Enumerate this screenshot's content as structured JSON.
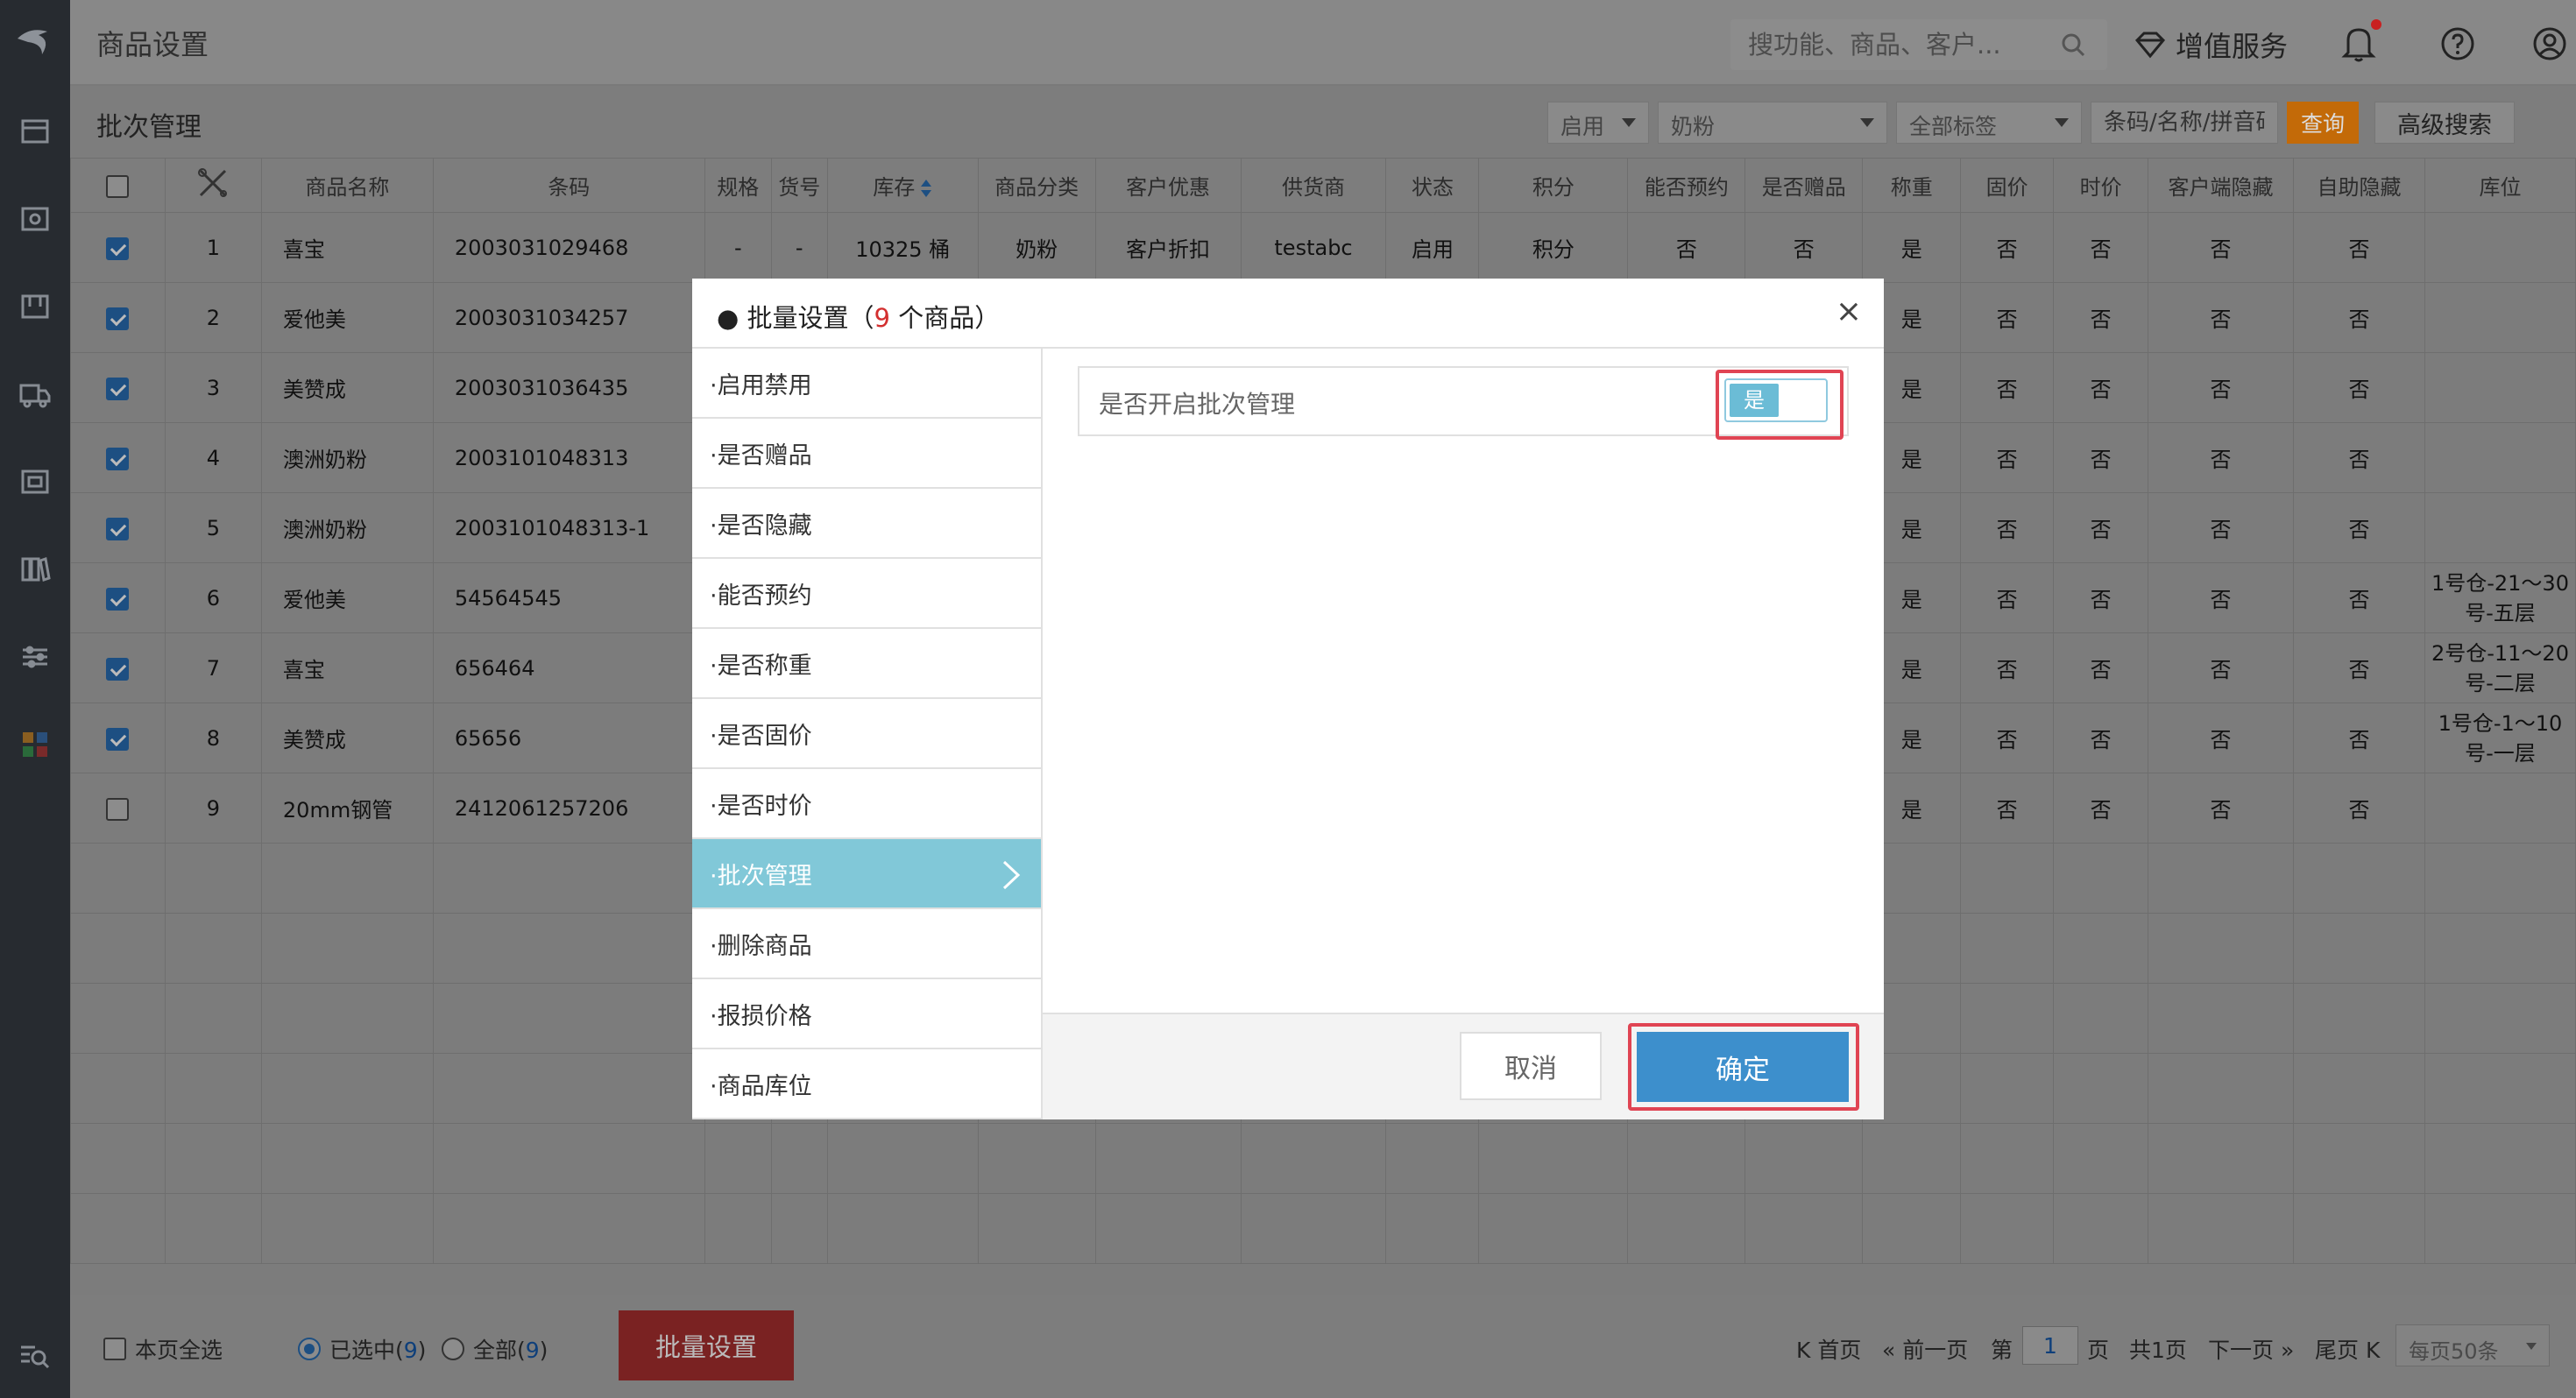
{
  "header": {
    "title": "商品设置",
    "search_placeholder": "搜功能、商品、客户...",
    "value_added": "增值服务"
  },
  "filter": {
    "title": "批次管理",
    "status": "启用",
    "category": "奶粉",
    "tags": "全部标签",
    "keyword_placeholder": "条码/名称/拼音码",
    "query": "查询",
    "advanced": "高级搜索"
  },
  "table": {
    "headers": [
      "商品名称",
      "条码",
      "规格",
      "货号",
      "库存",
      "商品分类",
      "客户优惠",
      "供货商",
      "状态",
      "积分",
      "能否预约",
      "是否赠品",
      "称重",
      "固价",
      "时价",
      "客户端隐藏",
      "自助隐藏",
      "库位"
    ],
    "rows": [
      {
        "checked": true,
        "idx": "1",
        "name": "喜宝",
        "code": "2003031029468",
        "spec": "-",
        "no": "-",
        "stock": "10325 桶",
        "cat": "奶粉",
        "disc": "客户折扣",
        "sup": "testabc",
        "status": "启用",
        "points": "积分",
        "res": "否",
        "gift": "否",
        "weigh": "是",
        "fixed": "否",
        "timep": "否",
        "chide": "否",
        "shide": "否",
        "loc": ""
      },
      {
        "checked": true,
        "idx": "2",
        "name": "爱他美",
        "code": "2003031034257",
        "weigh": "是",
        "fixed": "否",
        "timep": "否",
        "chide": "否",
        "shide": "否",
        "loc": ""
      },
      {
        "checked": true,
        "idx": "3",
        "name": "美赞成",
        "code": "2003031036435",
        "weigh": "是",
        "fixed": "否",
        "timep": "否",
        "chide": "否",
        "shide": "否",
        "loc": ""
      },
      {
        "checked": true,
        "idx": "4",
        "name": "澳洲奶粉",
        "code": "2003101048313",
        "weigh": "是",
        "fixed": "否",
        "timep": "否",
        "chide": "否",
        "shide": "否",
        "loc": ""
      },
      {
        "checked": true,
        "idx": "5",
        "name": "澳洲奶粉",
        "code": "2003101048313-1",
        "weigh": "是",
        "fixed": "否",
        "timep": "否",
        "chide": "否",
        "shide": "否",
        "loc": ""
      },
      {
        "checked": true,
        "idx": "6",
        "name": "爱他美",
        "code": "54564545",
        "weigh": "是",
        "fixed": "否",
        "timep": "否",
        "chide": "否",
        "shide": "否",
        "loc": "1号仓-21～30号-五层"
      },
      {
        "checked": true,
        "idx": "7",
        "name": "喜宝",
        "code": "656464",
        "weigh": "是",
        "fixed": "否",
        "timep": "否",
        "chide": "否",
        "shide": "否",
        "loc": "2号仓-11～20号-二层"
      },
      {
        "checked": true,
        "idx": "8",
        "name": "美赞成",
        "code": "65656",
        "weigh": "是",
        "fixed": "否",
        "timep": "否",
        "chide": "否",
        "shide": "否",
        "loc": "1号仓-1～10号-一层"
      },
      {
        "checked": false,
        "idx": "9",
        "name": "20mm钢管",
        "code": "2412061257206",
        "weigh": "是",
        "fixed": "否",
        "timep": "否",
        "chide": "否",
        "shide": "否",
        "loc": ""
      }
    ]
  },
  "bottom": {
    "select_page": "本页全选",
    "selected": "已选中(",
    "selected_count": "9",
    "all": "全部(",
    "all_count": "9",
    "close_paren": ")",
    "batch": "批量设置",
    "first": "首页",
    "prev": "前一页",
    "page_prefix": "第",
    "page_value": "1",
    "page_suffix": "页",
    "total": "共1页",
    "next": "下一页",
    "last": "尾页",
    "per_page": "每页50条"
  },
  "modal": {
    "title_prefix": "● 批量设置（",
    "count": "9",
    "title_suffix": " 个商品）",
    "close": "×",
    "menu": [
      "·启用禁用",
      "·是否赠品",
      "·是否隐藏",
      "·能否预约",
      "·是否称重",
      "·是否固价",
      "·是否时价",
      "·批次管理",
      "·删除商品",
      "·报损价格",
      "·商品库位"
    ],
    "option_label": "是否开启批次管理",
    "toggle_label": "是",
    "cancel": "取消",
    "ok": "确定"
  }
}
